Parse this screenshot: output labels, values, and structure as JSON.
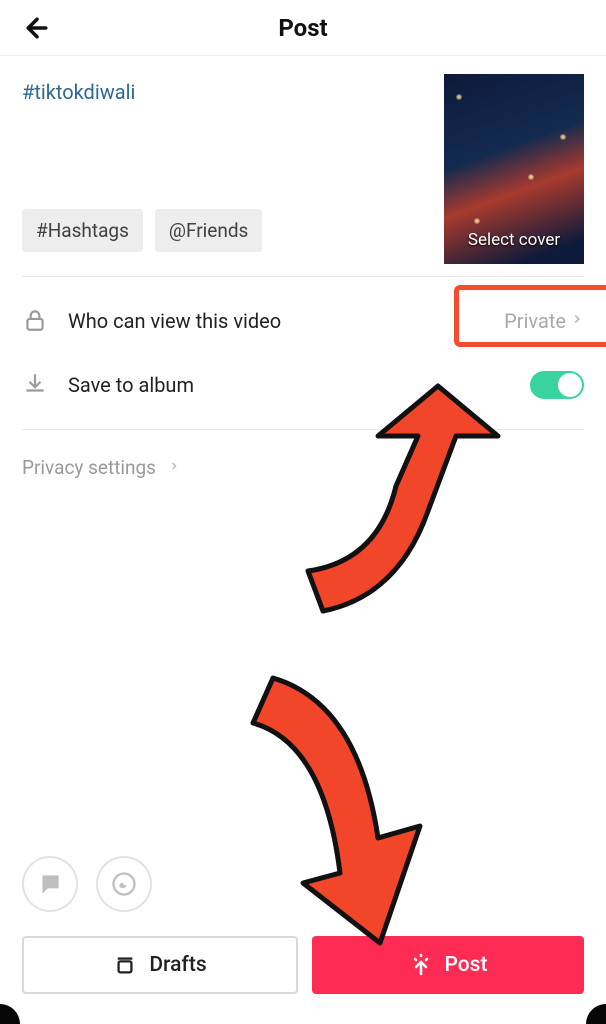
{
  "header": {
    "title": "Post"
  },
  "caption": {
    "hashtag": "#tiktokdiwali"
  },
  "chips": {
    "hashtags": "#Hashtags",
    "friends": "@Friends"
  },
  "cover": {
    "label": "Select cover"
  },
  "privacy_option": {
    "label": "Who can view this video",
    "value": "Private"
  },
  "save_option": {
    "label": "Save to album",
    "toggled": true
  },
  "privacy_link": {
    "label": "Privacy settings"
  },
  "buttons": {
    "drafts": "Drafts",
    "post": "Post"
  }
}
